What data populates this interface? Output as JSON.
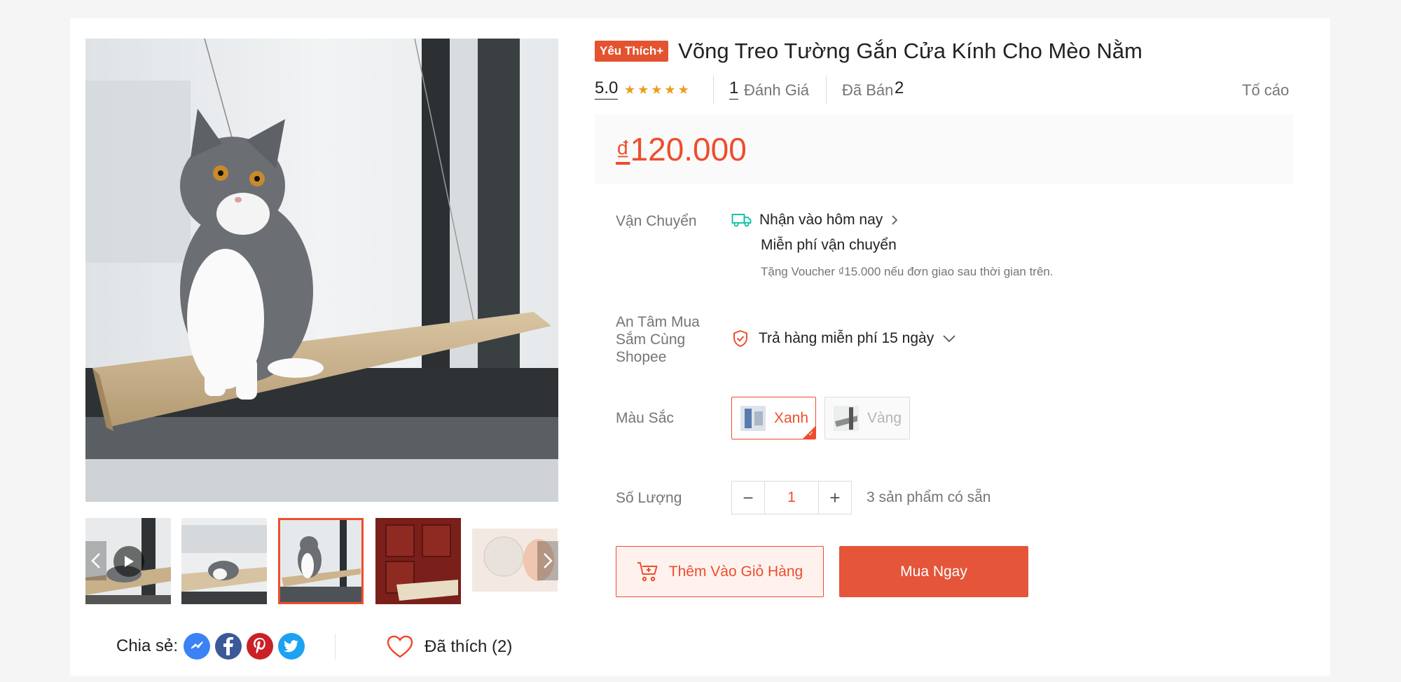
{
  "product": {
    "badge": "Yêu Thích+",
    "title": "Võng Treo Tường Gắn Cửa Kính Cho Mèo Nằm",
    "rating": "5.0",
    "stars": 5,
    "reviews_count": "1",
    "reviews_label": "Đánh Giá",
    "sold_label": "Đã Bán",
    "sold_count": "2",
    "report_label": "Tố cáo",
    "price_currency": "₫",
    "price_value": "120.000"
  },
  "shipping": {
    "label": "Vận Chuyển",
    "delivery": "Nhận vào hôm nay",
    "free_shipping": "Miễn phí vận chuyển",
    "voucher_note": "Tặng Voucher ₫15.000 nếu đơn giao sau thời gian trên."
  },
  "guarantee": {
    "label": "An Tâm Mua Sắm Cùng Shopee",
    "text": "Trả hàng miễn phí 15 ngày"
  },
  "color": {
    "label": "Màu Sắc",
    "options": [
      {
        "name": "Xanh",
        "selected": true
      },
      {
        "name": "Vàng",
        "selected": false
      }
    ]
  },
  "quantity": {
    "label": "Số Lượng",
    "value": "1",
    "minus": "−",
    "plus": "+",
    "stock_text": "3 sản phẩm có sẵn"
  },
  "actions": {
    "add_to_cart": "Thêm Vào Giỏ Hàng",
    "buy_now": "Mua Ngay"
  },
  "share": {
    "label": "Chia sẻ:",
    "networks": [
      "messenger-icon",
      "facebook-icon",
      "pinterest-icon",
      "twitter-icon"
    ]
  },
  "like": {
    "text": "Đã thích (2)"
  },
  "colors": {
    "accent": "#ee4d2d",
    "badge": "#e4532f",
    "star": "#ee9b1e",
    "messenger": "#3b82f6",
    "facebook": "#3b5998",
    "pinterest": "#cb2027",
    "twitter": "#1da1f2"
  }
}
